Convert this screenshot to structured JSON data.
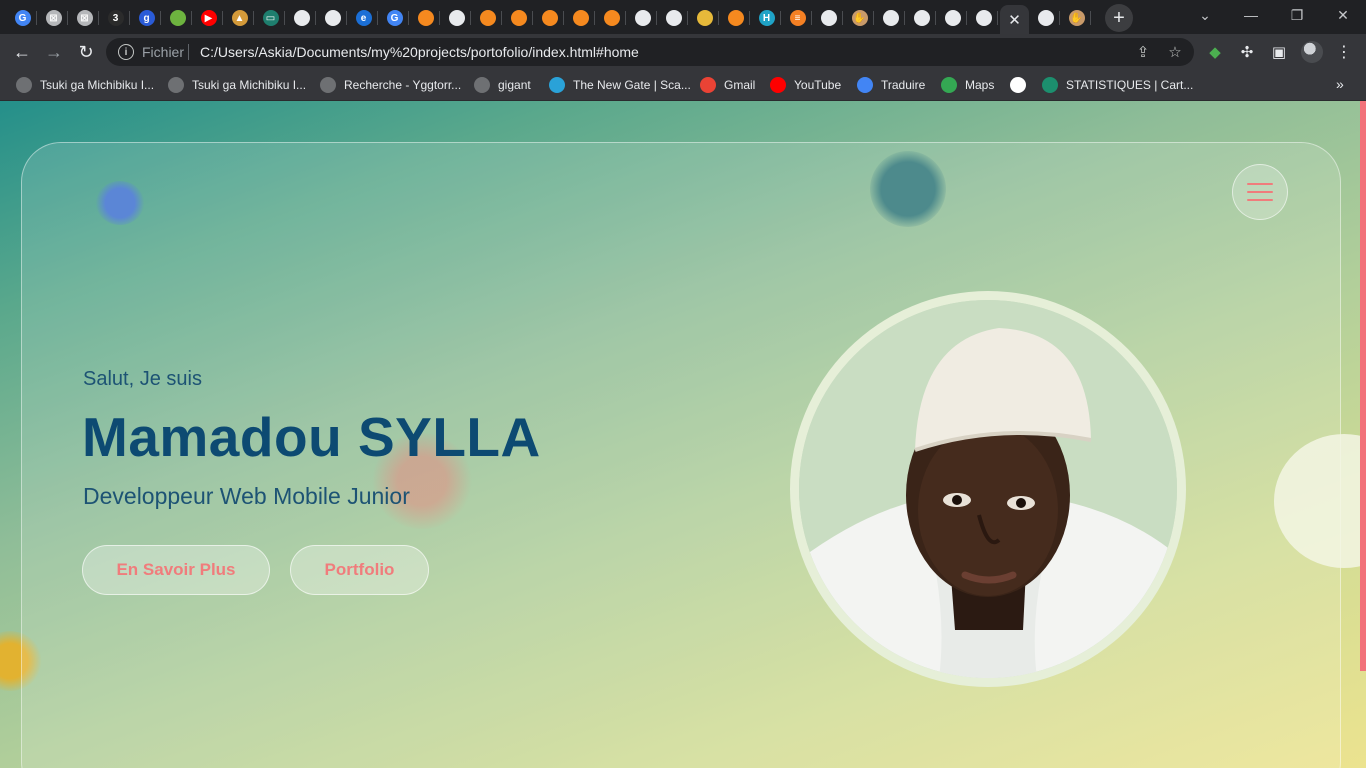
{
  "browser": {
    "tabs": [
      {
        "icon": "google-icon",
        "color": "#4285f4",
        "glyph": "G"
      },
      {
        "icon": "xampp-icon",
        "color": "#b5b7ba",
        "glyph": "⊠"
      },
      {
        "icon": "xampp-icon",
        "color": "#b5b7ba",
        "glyph": "⊠"
      },
      {
        "icon": "three-icon",
        "color": "#2b2b2b",
        "glyph": "3"
      },
      {
        "icon": "g-letter-icon",
        "color": "#2a5bd7",
        "glyph": "g"
      },
      {
        "icon": "leaf-icon",
        "color": "#6db33f",
        "glyph": ""
      },
      {
        "icon": "youtube-icon",
        "color": "#ff0000",
        "glyph": "▶"
      },
      {
        "icon": "sail-icon",
        "color": "#d49a3a",
        "glyph": "▲"
      },
      {
        "icon": "battery-icon",
        "color": "#1e7e6e",
        "glyph": "▭"
      },
      {
        "icon": "globe-icon",
        "color": "#e8eaed",
        "glyph": ""
      },
      {
        "icon": "globe-icon",
        "color": "#e8eaed",
        "glyph": ""
      },
      {
        "icon": "edge-icon",
        "color": "#1b6fd6",
        "glyph": "e"
      },
      {
        "icon": "google-icon",
        "color": "#4285f4",
        "glyph": "G"
      },
      {
        "icon": "box-icon",
        "color": "#f5891f",
        "glyph": ""
      },
      {
        "icon": "globe-icon",
        "color": "#e8eaed",
        "glyph": ""
      },
      {
        "icon": "box-icon",
        "color": "#f5891f",
        "glyph": ""
      },
      {
        "icon": "box-icon",
        "color": "#f5891f",
        "glyph": ""
      },
      {
        "icon": "box-icon",
        "color": "#f5891f",
        "glyph": ""
      },
      {
        "icon": "box-icon",
        "color": "#f5891f",
        "glyph": ""
      },
      {
        "icon": "box-icon",
        "color": "#f5891f",
        "glyph": ""
      },
      {
        "icon": "globe-icon",
        "color": "#e8eaed",
        "glyph": ""
      },
      {
        "icon": "globe-icon",
        "color": "#e8eaed",
        "glyph": ""
      },
      {
        "icon": "package-icon",
        "color": "#e6b93a",
        "glyph": ""
      },
      {
        "icon": "box-icon",
        "color": "#f5891f",
        "glyph": ""
      },
      {
        "icon": "h-circle-icon",
        "color": "#1fa3c7",
        "glyph": "H"
      },
      {
        "icon": "stackoverflow-icon",
        "color": "#f48024",
        "glyph": "≡"
      },
      {
        "icon": "globe-icon",
        "color": "#e8eaed",
        "glyph": ""
      },
      {
        "icon": "hand-icon",
        "color": "#c99a6a",
        "glyph": "✋"
      },
      {
        "icon": "globe-icon",
        "color": "#e8eaed",
        "glyph": ""
      },
      {
        "icon": "globe-icon",
        "color": "#e8eaed",
        "glyph": ""
      },
      {
        "icon": "globe-icon",
        "color": "#e8eaed",
        "glyph": ""
      },
      {
        "icon": "globe-icon",
        "color": "#e8eaed",
        "glyph": ""
      },
      {
        "icon": "close-icon",
        "color": "#e8eaed",
        "glyph": "✕",
        "active": true
      },
      {
        "icon": "globe-icon",
        "color": "#e8eaed",
        "glyph": ""
      },
      {
        "icon": "hand-icon",
        "color": "#c99a6a",
        "glyph": "✋"
      }
    ],
    "new_tab_label": "+",
    "window_controls": {
      "tab_search": "⌄",
      "minimize": "—",
      "restore": "❐",
      "close": "✕"
    },
    "nav": {
      "back": "←",
      "forward": "→",
      "reload": "↻"
    },
    "address": {
      "scheme": "Fichier",
      "url": "C:/Users/Askia/Documents/my%20projects/portofolio/index.html#home"
    },
    "omnibox_icons": {
      "share": "⇪",
      "bookmark": "☆"
    },
    "extensions": {
      "ext1": "◆",
      "puzzle": "✣",
      "sidepanel": "▣",
      "menu": "⋮"
    },
    "bookmarks": [
      {
        "label": "Tsuki ga Michibiku I...",
        "icon": "globe-icon",
        "color": "#6e7073"
      },
      {
        "label": "Tsuki ga Michibiku I...",
        "icon": "globe-icon",
        "color": "#6e7073"
      },
      {
        "label": "Recherche - Yggtorr...",
        "icon": "globe-icon",
        "color": "#6e7073"
      },
      {
        "label": "gigant",
        "icon": "globe-icon",
        "color": "#6e7073"
      },
      {
        "label": "The New Gate | Sca...",
        "icon": "checkbox-icon",
        "color": "#2aa2d8"
      },
      {
        "label": "Gmail",
        "icon": "gmail-icon",
        "color": "#ea4335"
      },
      {
        "label": "YouTube",
        "icon": "youtube-icon",
        "color": "#ff0000"
      },
      {
        "label": "Traduire",
        "icon": "translate-icon",
        "color": "#4285f4"
      },
      {
        "label": "Maps",
        "icon": "maps-icon",
        "color": "#34a853"
      },
      {
        "label": "",
        "icon": "google-icon",
        "color": "#ffffff"
      },
      {
        "label": "STATISTIQUES | Cart...",
        "icon": "k-icon",
        "color": "#1c8f6e"
      }
    ],
    "bookmarks_more": "»"
  },
  "page": {
    "greeting": "Salut, Je suis",
    "name": "Mamadou SYLLA",
    "role": "Developpeur Web Mobile Junior",
    "buttons": {
      "learn_more": "En Savoir Plus",
      "portfolio": "Portfolio"
    },
    "colors": {
      "accent": "#f07c7c",
      "name": "#0d4a72"
    }
  }
}
